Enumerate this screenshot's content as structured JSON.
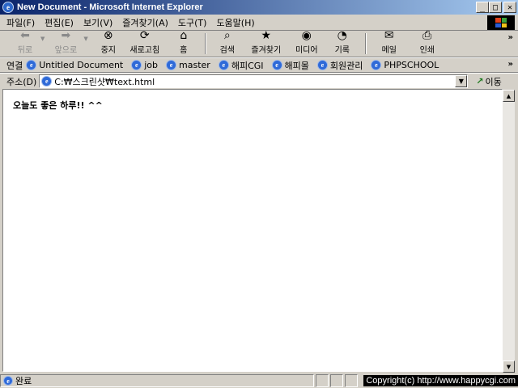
{
  "window": {
    "title": "New Document - Microsoft Internet Explorer"
  },
  "menu": [
    "파일(F)",
    "편집(E)",
    "보기(V)",
    "즐겨찾기(A)",
    "도구(T)",
    "도움말(H)"
  ],
  "toolbar": {
    "back": "뒤로",
    "forward": "앞으로",
    "stop": "중지",
    "refresh": "새로고침",
    "home": "홈",
    "search": "검색",
    "favorites": "즐겨찾기",
    "media": "미디어",
    "history": "기록",
    "mail": "메일",
    "print": "인쇄"
  },
  "links": {
    "label": "연결",
    "items": [
      "Untitled Document",
      "job",
      "master",
      "해피CGI",
      "해피몰",
      "회원관리",
      "PHPSCHOOL"
    ]
  },
  "address": {
    "label": "주소(D)",
    "value": "C:₩스크린샷₩text.html",
    "go": "이동"
  },
  "page": {
    "text": "오늘도 좋은 하루!! ^^"
  },
  "status": {
    "text": "완료",
    "copyright": "Copyright(c) http://www.happycgi.com"
  },
  "colors": {
    "titlebar_start": "#0a246a",
    "titlebar_end": "#a6caf0",
    "chrome": "#d4d0c8"
  }
}
